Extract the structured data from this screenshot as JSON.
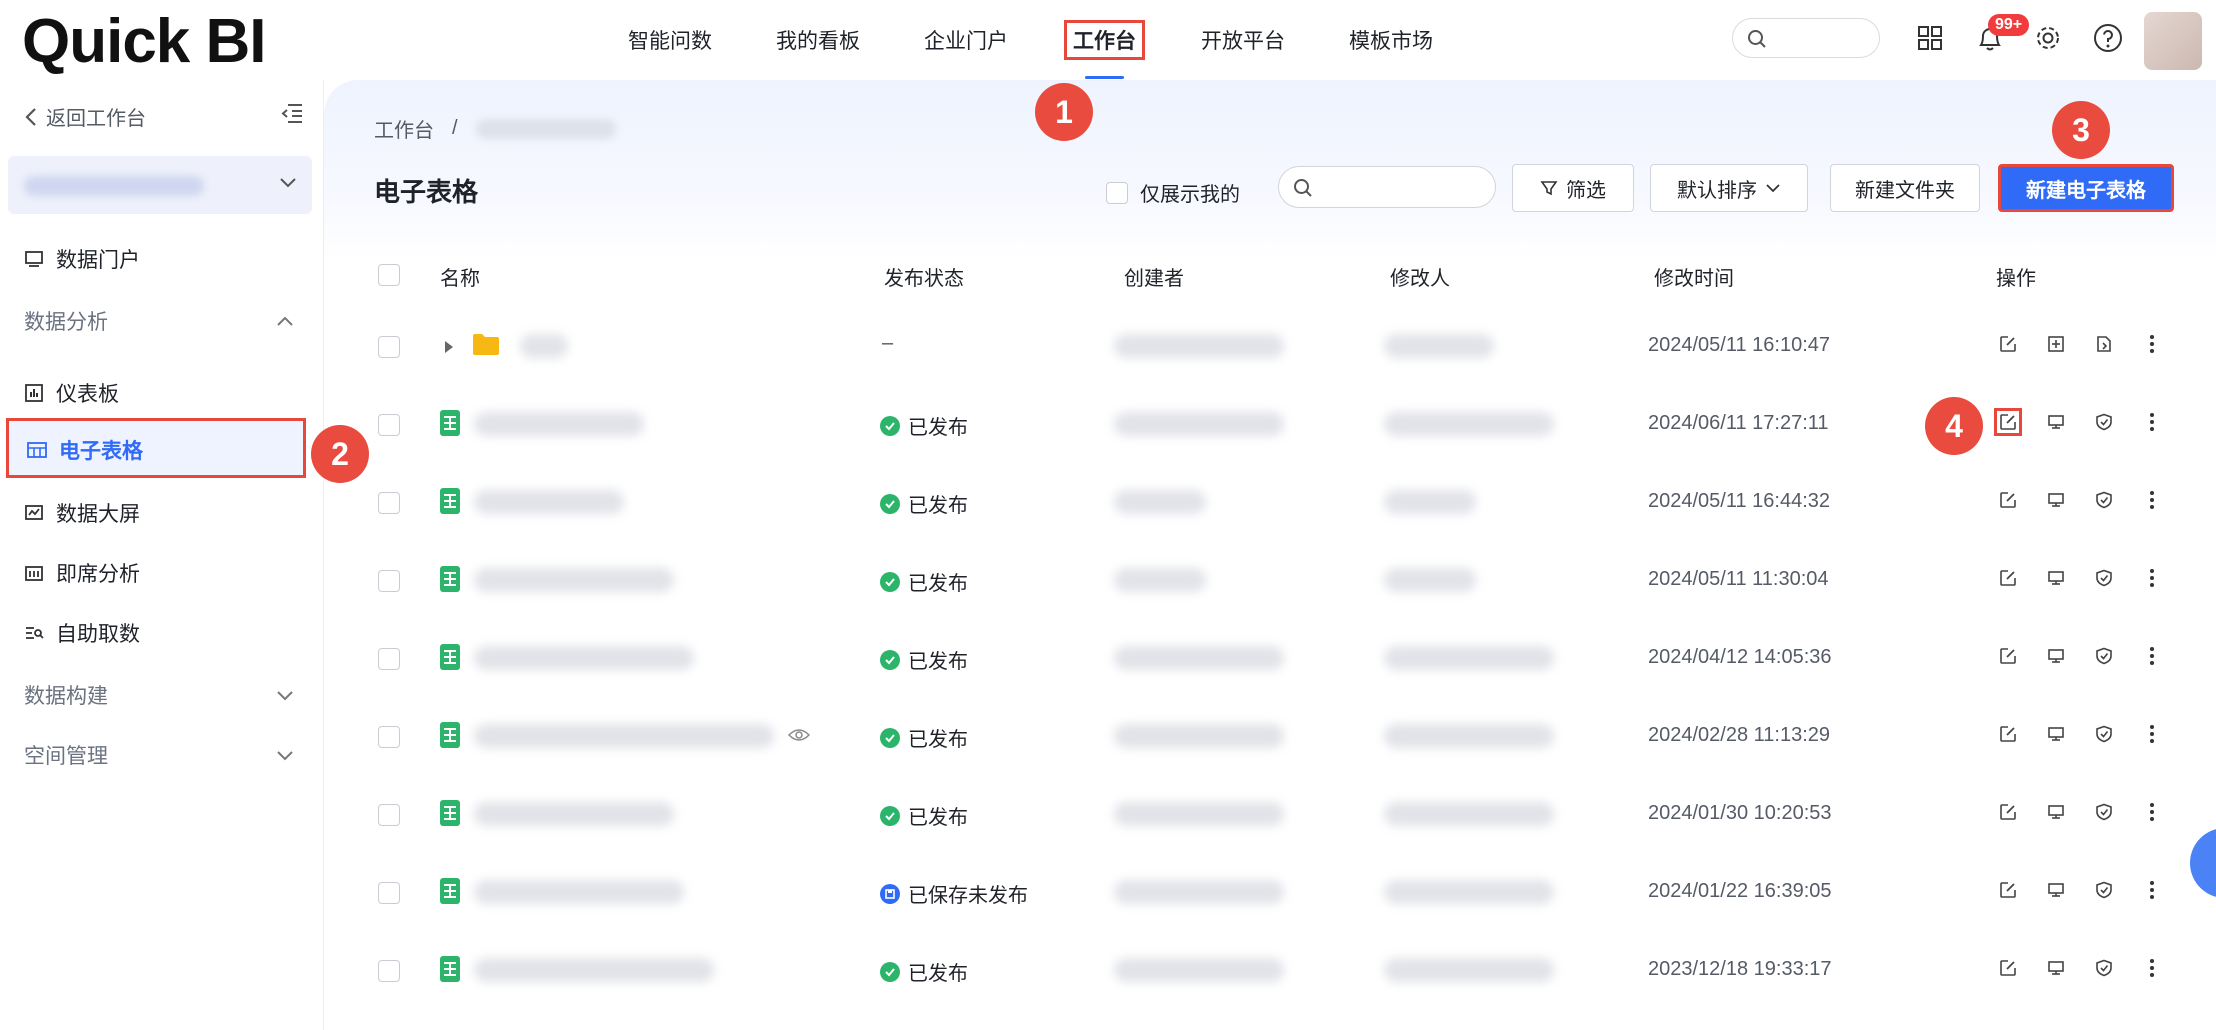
{
  "header": {
    "logo": "Quick BI",
    "nav": [
      "智能问数",
      "我的看板",
      "企业门户",
      "工作台",
      "开放平台",
      "模板市场"
    ],
    "active_nav": "工作台",
    "notification_badge": "99+"
  },
  "sidebar": {
    "back_label": "返回工作台",
    "items": {
      "data_portal": "数据门户",
      "data_analysis": "数据分析",
      "dashboard": "仪表板",
      "spreadsheet": "电子表格",
      "big_screen": "数据大屏",
      "adhoc": "即席分析",
      "self_service": "自助取数",
      "data_build": "数据构建",
      "space_mgmt": "空间管理"
    }
  },
  "main": {
    "breadcrumb_root": "工作台",
    "breadcrumb_sep": "/",
    "title": "电子表格",
    "only_mine": "仅展示我的",
    "filter_label": "筛选",
    "sort_label": "默认排序",
    "new_folder": "新建文件夹",
    "new_spreadsheet": "新建电子表格"
  },
  "table": {
    "columns": {
      "name": "名称",
      "status": "发布状态",
      "creator": "创建者",
      "modifier": "修改人",
      "mtime": "修改时间",
      "ops": "操作"
    },
    "rows": [
      {
        "type": "folder",
        "status": "–",
        "time": "2024/05/11 16:10:47"
      },
      {
        "type": "sheet",
        "status": "已发布",
        "time": "2024/06/11 17:27:11"
      },
      {
        "type": "sheet",
        "status": "已发布",
        "time": "2024/05/11 16:44:32"
      },
      {
        "type": "sheet",
        "status": "已发布",
        "time": "2024/05/11 11:30:04"
      },
      {
        "type": "sheet",
        "status": "已发布",
        "time": "2024/04/12 14:05:36"
      },
      {
        "type": "sheet",
        "status": "已发布",
        "time": "2024/02/28 11:13:29"
      },
      {
        "type": "sheet",
        "status": "已发布",
        "time": "2024/01/30 10:20:53"
      },
      {
        "type": "sheet",
        "status": "已保存未发布",
        "time": "2024/01/22 16:39:05"
      },
      {
        "type": "sheet",
        "status": "已发布",
        "time": "2023/12/18 19:33:17"
      }
    ]
  },
  "markers": [
    "1",
    "2",
    "3",
    "4"
  ],
  "colors": {
    "primary": "#2f6bf6",
    "highlight": "#e8483c",
    "published": "#2db46b",
    "saved": "#2f6bf6"
  }
}
